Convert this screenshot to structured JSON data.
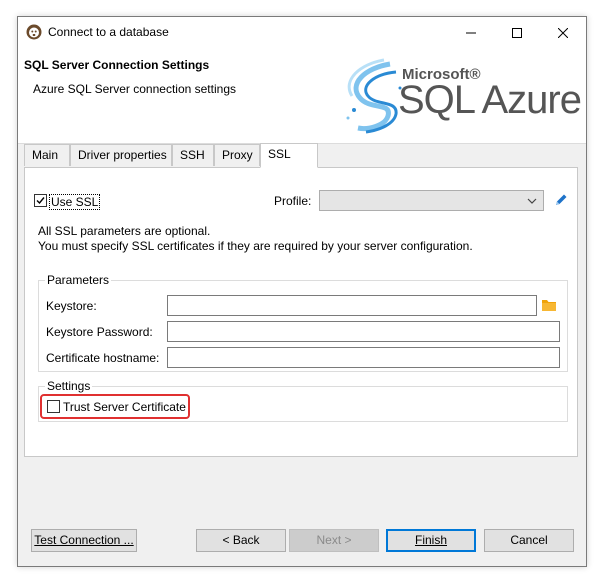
{
  "window": {
    "title": "Connect to a database"
  },
  "banner": {
    "title": "SQL Server Connection Settings",
    "subtitle": "Azure SQL Server connection settings",
    "logo_brand": "Microsoft®",
    "logo_product": "SQL Azure"
  },
  "tabs": [
    {
      "label": "Main"
    },
    {
      "label": "Driver properties"
    },
    {
      "label": "SSH"
    },
    {
      "label": "Proxy"
    },
    {
      "label": "SSL"
    }
  ],
  "active_tab": "SSL",
  "ssl": {
    "use_ssl_label": "Use SSL",
    "use_ssl_checked": true,
    "profile_label": "Profile:",
    "profile_value": "",
    "info_line1": "All SSL parameters are optional.",
    "info_line2": "You must specify SSL certificates if they are required by your server configuration."
  },
  "parameters": {
    "legend": "Parameters",
    "keystore_label": "Keystore:",
    "keystore_value": "",
    "keystore_password_label": "Keystore Password:",
    "keystore_password_value": "",
    "cert_hostname_label": "Certificate hostname:",
    "cert_hostname_value": ""
  },
  "settings": {
    "legend": "Settings",
    "trust_cert_label": "Trust Server Certificate",
    "trust_cert_checked": false
  },
  "footer": {
    "test_connection": "Test Connection ...",
    "back": "< Back",
    "next": "Next >",
    "finish": "Finish",
    "cancel": "Cancel"
  },
  "colors": {
    "accent": "#0078d7",
    "highlight": "#e03030",
    "folder": "#f0a30a",
    "logo_blue": "#2a8ad4"
  },
  "icons": {
    "app": "dbeaver-icon",
    "profile_edit": "pencil-icon",
    "keystore_browse": "folder-icon"
  }
}
